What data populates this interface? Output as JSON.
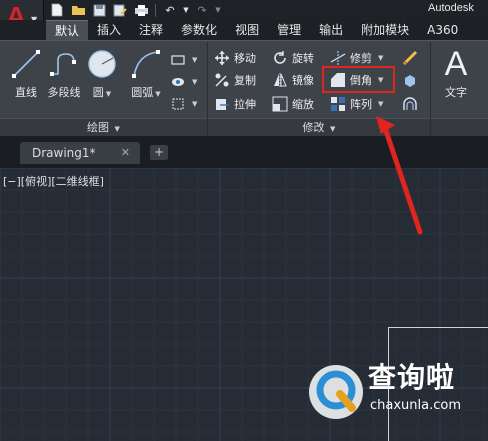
{
  "app": {
    "logo_letter": "A",
    "window_title": "Autodesk",
    "quick_access": [
      "new-file-icon",
      "open-icon",
      "save-icon",
      "save-as-icon",
      "print-icon",
      "undo-icon",
      "redo-icon"
    ]
  },
  "ribbon": {
    "tabs": [
      {
        "label": "默认",
        "active": true
      },
      {
        "label": "插入",
        "active": false
      },
      {
        "label": "注释",
        "active": false
      },
      {
        "label": "参数化",
        "active": false
      },
      {
        "label": "视图",
        "active": false
      },
      {
        "label": "管理",
        "active": false
      },
      {
        "label": "输出",
        "active": false
      },
      {
        "label": "附加模块",
        "active": false
      },
      {
        "label": "A360",
        "active": false
      }
    ],
    "draw_panel": {
      "label": "绘图",
      "tools": [
        "直线",
        "多段线",
        "圆",
        "圆弧"
      ]
    },
    "modify_panel": {
      "label": "修改",
      "row1": [
        "移动",
        "旋转",
        "修剪"
      ],
      "row2": [
        "复制",
        "镜像",
        "倒角"
      ],
      "row3": [
        "拉伸",
        "缩放",
        "阵列"
      ]
    },
    "annotation_panel": {
      "tools": [
        "文字"
      ]
    }
  },
  "document": {
    "tab_title": "Drawing1*",
    "close": "✕",
    "new_tab": "+"
  },
  "viewport": {
    "label": "[−][俯视][二维线框]"
  },
  "watermark": {
    "main": "查询啦",
    "sub": "chaxunla.com"
  },
  "colors": {
    "accent_red": "#e0241e",
    "canvas": "#252c35",
    "ribbon": "#3e434a"
  }
}
